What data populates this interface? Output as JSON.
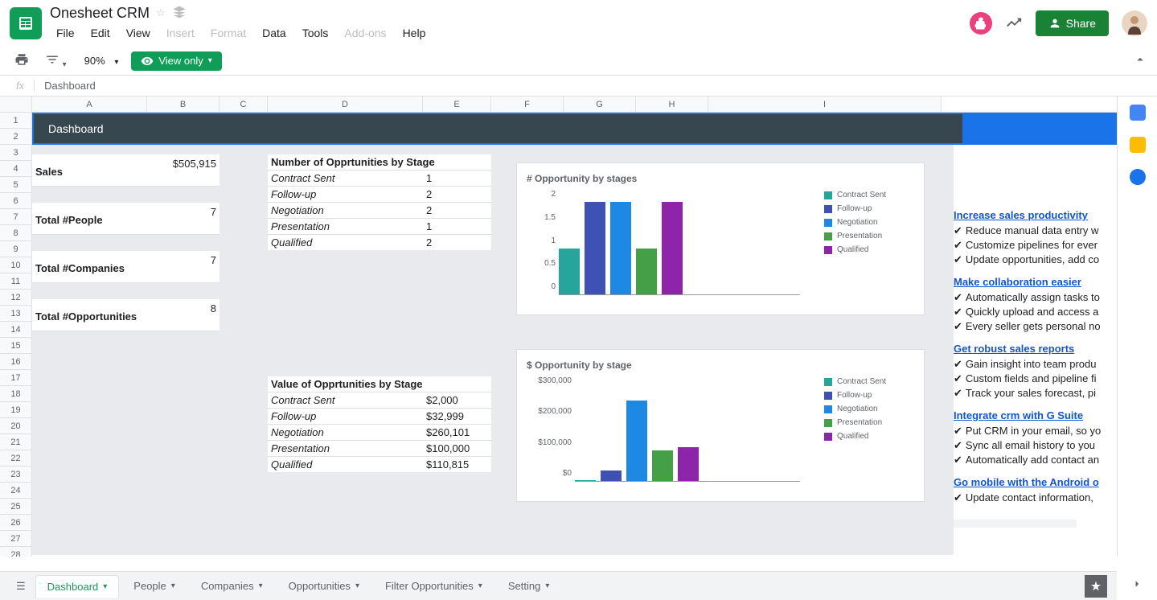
{
  "doc_title": "Onesheet CRM",
  "menu": [
    "File",
    "Edit",
    "View",
    "Insert",
    "Format",
    "Data",
    "Tools",
    "Add-ons",
    "Help"
  ],
  "menu_disabled": [
    "Insert",
    "Format",
    "Add-ons"
  ],
  "zoom": "90%",
  "view_only": "View only",
  "share": "Share",
  "formula_value": "Dashboard",
  "columns": [
    "A",
    "B",
    "C",
    "D",
    "E",
    "F",
    "G",
    "H",
    "I"
  ],
  "banner": "Dashboard",
  "summary": {
    "sales_label": "Sales",
    "sales_value": "$505,915",
    "people_label": "Total #People",
    "people_value": "7",
    "companies_label": "Total #Companies",
    "companies_value": "7",
    "opps_label": "Total #Opportunities",
    "opps_value": "8"
  },
  "stage_count": {
    "title": "Number of Opprtunities by Stage",
    "rows": [
      {
        "name": "Contract Sent",
        "val": "1"
      },
      {
        "name": "Follow-up",
        "val": "2"
      },
      {
        "name": "Negotiation",
        "val": "2"
      },
      {
        "name": "Presentation",
        "val": "1"
      },
      {
        "name": "Qualified",
        "val": "2"
      }
    ]
  },
  "stage_value": {
    "title": "Value of Opprtunities by Stage",
    "rows": [
      {
        "name": "Contract Sent",
        "val": "$2,000"
      },
      {
        "name": "Follow-up",
        "val": "$32,999"
      },
      {
        "name": "Negotiation",
        "val": "$260,101"
      },
      {
        "name": "Presentation",
        "val": "$100,000"
      },
      {
        "name": "Qualified",
        "val": "$110,815"
      }
    ]
  },
  "chart_data": [
    {
      "type": "bar",
      "title": "# Opportunity by stages",
      "categories": [
        "Contract Sent",
        "Follow-up",
        "Negotiation",
        "Presentation",
        "Qualified"
      ],
      "values": [
        1,
        2,
        2,
        1,
        2
      ],
      "xlabel": "",
      "ylabel": "",
      "ylim": [
        0,
        2
      ],
      "yticks": [
        "0",
        "0.5",
        "1",
        "1.5",
        "2"
      ],
      "colors": [
        "#26a69a",
        "#3f51b5",
        "#1e88e5",
        "#43a047",
        "#8e24aa"
      ]
    },
    {
      "type": "bar",
      "title": "$ Opportunity by stage",
      "categories": [
        "Contract Sent",
        "Follow-up",
        "Negotiation",
        "Presentation",
        "Qualified"
      ],
      "values": [
        2000,
        32999,
        260101,
        100000,
        110815
      ],
      "xlabel": "",
      "ylabel": "",
      "ylim": [
        0,
        300000
      ],
      "yticks": [
        "$0",
        "$100,000",
        "$200,000",
        "$300,000"
      ],
      "colors": [
        "#26a69a",
        "#3f51b5",
        "#1e88e5",
        "#43a047",
        "#8e24aa"
      ]
    }
  ],
  "info": {
    "sections": [
      {
        "link": "Increase sales productivity",
        "items": [
          "Reduce manual data entry w",
          "Customize pipelines for ever",
          "Update opportunities, add co"
        ]
      },
      {
        "link": "Make collaboration easier",
        "items": [
          "Automatically assign tasks to",
          "Quickly upload and access a",
          "Every seller gets personal no"
        ]
      },
      {
        "link": "Get robust sales reports",
        "items": [
          "Gain insight into team produ",
          "Custom fields and pipeline fi",
          "Track your sales forecast, pi"
        ]
      },
      {
        "link": "Integrate crm with G Suite",
        "items": [
          "Put CRM in your email, so yo",
          "Sync all email history to you",
          "Automatically add contact an"
        ]
      },
      {
        "link": "Go mobile with the Android o",
        "items": [
          "Update contact information,"
        ]
      }
    ]
  },
  "tabs": [
    "Dashboard",
    "People",
    "Companies",
    "Opportunities",
    "Filter Opportunities",
    "Setting"
  ],
  "active_tab": "Dashboard"
}
